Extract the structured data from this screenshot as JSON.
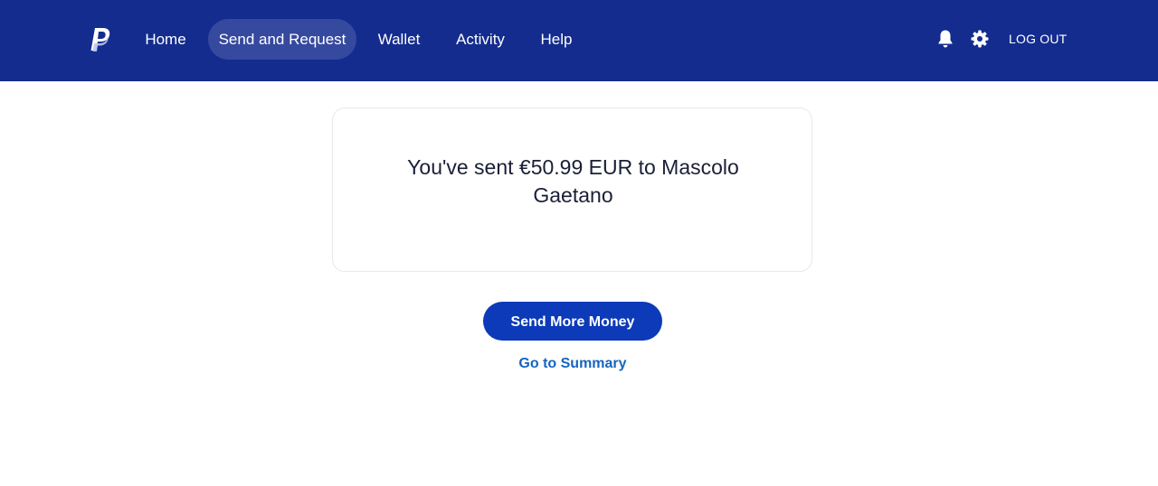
{
  "colors": {
    "header_bg": "#142c8e",
    "primary_button": "#0c3ab8",
    "link": "#1565c0",
    "text": "#1a1f36"
  },
  "header": {
    "logo_icon": "paypal-logo",
    "nav": [
      {
        "label": "Home",
        "active": false
      },
      {
        "label": "Send and Request",
        "active": true
      },
      {
        "label": "Wallet",
        "active": false
      },
      {
        "label": "Activity",
        "active": false
      },
      {
        "label": "Help",
        "active": false
      }
    ],
    "notifications_icon": "bell-icon",
    "settings_icon": "gear-icon",
    "logout_label": "LOG OUT"
  },
  "confirmation": {
    "message": "You've sent €50.99 EUR to Mascolo Gaetano"
  },
  "actions": {
    "primary_label": "Send More Money",
    "link_label": "Go to Summary"
  }
}
